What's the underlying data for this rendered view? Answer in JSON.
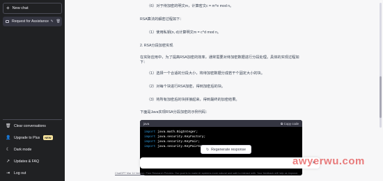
{
  "sidebar": {
    "new_chat": "New chat",
    "chat_item": "Request for Assistance",
    "menu": [
      {
        "label": "Clear conversations",
        "icon": "trash-icon"
      },
      {
        "label": "Upgrade to Plus",
        "icon": "user-icon",
        "badge": "NEW"
      },
      {
        "label": "Dark mode",
        "icon": "moon-icon"
      },
      {
        "label": "Updates & FAQ",
        "icon": "external-link-icon"
      },
      {
        "label": "Log out",
        "icon": "logout-icon"
      }
    ]
  },
  "content": {
    "p1": "（6）对于待加密的明文m，计算密文c = m^e mod n。",
    "p2": "RSA算法的解密过程如下：",
    "p3": "（1）使用私钥(n, d)计算明文m = c^d mod n。",
    "p4": "2.  RSA分段加密实现",
    "p5": "在实际应用中，为了提高RSA加密的效率，通常需要对待加密数据进行分段处理。具体的实现过程如下：",
    "p6": "（1）选择一个合适的分段大小，将待加密数据分成若干个固定大小的块。",
    "p7": "（2）对每个块进行RSA加密，得到加密后的块。",
    "p8": "（3）将所有加密后的块拼接起来，得到最终的加密结果。",
    "p9": "下面是Java实现RSA分段加密的示例代码："
  },
  "code": {
    "lang": "java",
    "copy": "Copy code",
    "lines": [
      {
        "kw": "import",
        "rest": " java.math.BigInteger;"
      },
      {
        "kw": "import",
        "rest": " java.security.KeyFactory;"
      },
      {
        "kw": "import",
        "rest": " java.security.KeyPair;"
      },
      {
        "kw": "import",
        "rest": " java.security.KeyPairGenerator;"
      }
    ]
  },
  "regenerate": "Regenerate response",
  "footer": {
    "link": "ChatGPT Mar 14 Version",
    "text": ". Free Research Preview. Our goal is to make AI systems more natural and safe to interact with. Your feedback will help us improve."
  },
  "watermark": "awyerwu.com",
  "colors": {
    "sidebar": "#202123",
    "code_bg": "#000000",
    "keyword": "#2e95d3",
    "watermark": "#dc1414"
  }
}
